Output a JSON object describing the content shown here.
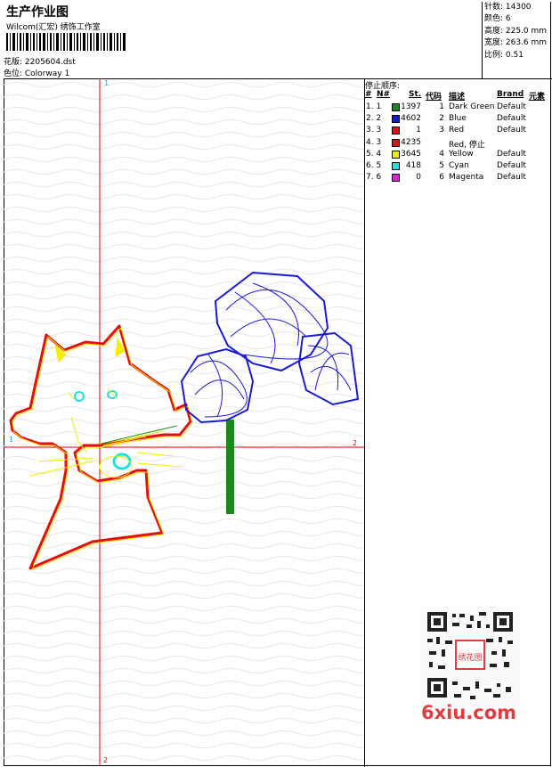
{
  "header": {
    "title": "生产作业图",
    "subtitle": "Wilcom(汇宏) 绣饰工作室",
    "design_label": "花版: 2205604.dst",
    "colorway_label": "色位:  Colorway 1"
  },
  "stats": {
    "stitches": "针数: 14300",
    "colors": "颜色: 6",
    "height": "高度: 225.0 mm",
    "width": "宽度: 263.6 mm",
    "scale": "比例: 0.51"
  },
  "sequence": {
    "title": "停止顺序:",
    "columns": [
      "#",
      "N#",
      "St.",
      "代码",
      "描述",
      "Brand",
      "元素"
    ],
    "rows": [
      {
        "idx": "1. 1",
        "st": "1397",
        "code": "1",
        "desc": "Dark Green",
        "brand": "Default",
        "color": "#1a8a1a"
      },
      {
        "idx": "2. 2",
        "st": "4602",
        "code": "2",
        "desc": "Blue",
        "brand": "Default",
        "color": "#1a1ad6"
      },
      {
        "idx": "3. 3",
        "st": "1",
        "code": "3",
        "desc": "Red",
        "brand": "Default",
        "color": "#e01010"
      },
      {
        "idx": "4. 3",
        "st": "4235",
        "code": "",
        "desc": "Red, 停止",
        "brand": "",
        "color": "#e01010"
      },
      {
        "idx": "5. 4",
        "st": "3645",
        "code": "4",
        "desc": "Yellow",
        "brand": "Default",
        "color": "#f0f000"
      },
      {
        "idx": "6. 5",
        "st": "418",
        "code": "5",
        "desc": "Cyan",
        "brand": "Default",
        "color": "#20e0e0"
      },
      {
        "idx": "7. 6",
        "st": "0",
        "code": "6",
        "desc": "Magenta",
        "brand": "Default",
        "color": "#e020e0"
      }
    ]
  },
  "axes": {
    "top_label": "1",
    "bottom_label": "2",
    "right_label": "2",
    "left_label": "1"
  },
  "watermark": {
    "text": "6xiu.com",
    "seal": "绣花图"
  }
}
